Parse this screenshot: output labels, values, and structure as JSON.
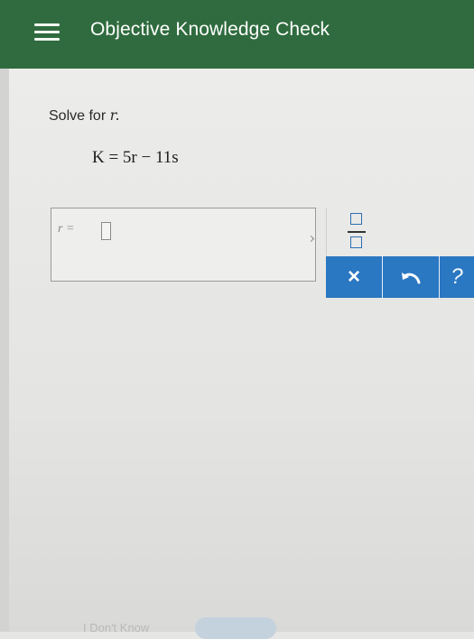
{
  "header": {
    "title": "Objective Knowledge Check",
    "menu_icon": "hamburger-menu-icon",
    "background": "#2f6b3e"
  },
  "question": {
    "prompt": "Solve for",
    "variable": "r.",
    "equation": "K = 5r − 11s"
  },
  "answer": {
    "label": "r =",
    "value": ""
  },
  "toolbar": {
    "fraction_icon": "fraction-icon",
    "clear_label": "×",
    "undo_icon": "undo-icon",
    "help_label": "?",
    "accent": "#2a77c2"
  },
  "footer": {
    "dont_know_label": "I Don't Know"
  }
}
